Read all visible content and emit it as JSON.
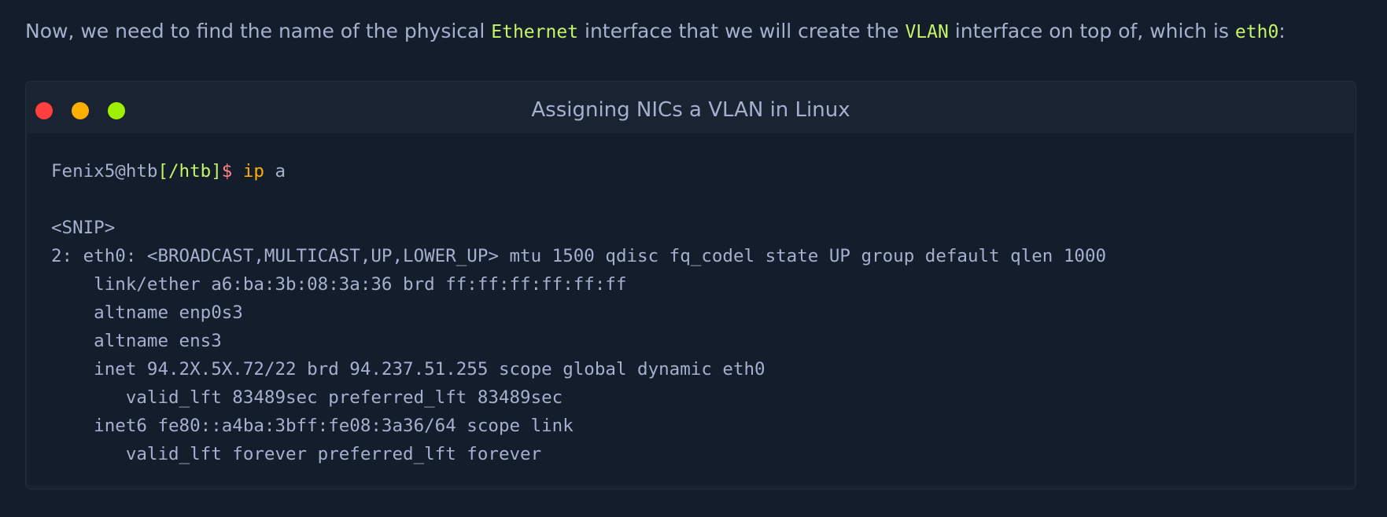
{
  "intro": {
    "text_1": "Now, we need to find the name of the physical ",
    "code_1": "Ethernet",
    "text_2": " interface that we will create the ",
    "code_2": "VLAN",
    "text_3": " interface on top of, which is ",
    "code_3": "eth0",
    "text_4": ":"
  },
  "terminal": {
    "title": "Assigning NICs a VLAN in Linux",
    "window_buttons": [
      "close",
      "minimize",
      "maximize"
    ],
    "prompt": {
      "user_host": "Fenix5@htb",
      "path": "[/htb]",
      "symbol": "$",
      "command": "ip",
      "argument": "a"
    },
    "output": [
      "",
      "<SNIP>",
      "2: eth0: <BROADCAST,MULTICAST,UP,LOWER_UP> mtu 1500 qdisc fq_codel state UP group default qlen 1000",
      "    link/ether a6:ba:3b:08:3a:36 brd ff:ff:ff:ff:ff:ff",
      "    altname enp0s3",
      "    altname ens3",
      "    inet 94.2X.5X.72/22 brd 94.237.51.255 scope global dynamic eth0",
      "       valid_lft 83489sec preferred_lft 83489sec",
      "    inet6 fe80::a4ba:3bff:fe08:3a36/64 scope link",
      "       valid_lft forever preferred_lft forever"
    ]
  },
  "colors": {
    "page_background": "#141d2b",
    "text": "#a4b1cd",
    "code_highlight": "#c5f467",
    "close_button": "#ff3e3e",
    "minimize_button": "#ffaf00",
    "maximize_button": "#9fef00",
    "prompt_symbol": "#ff8484",
    "command": "#ffaf00"
  }
}
